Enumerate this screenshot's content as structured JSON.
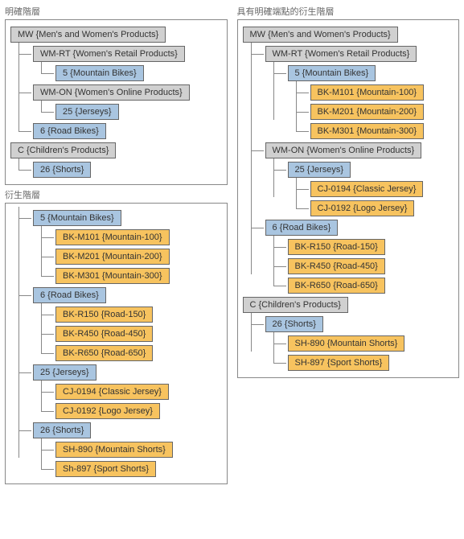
{
  "panels": {
    "explicit": {
      "title": "明確階層",
      "tree": [
        {
          "level": 0,
          "color": "gray",
          "text": "MW {Men's and Women's Products}"
        },
        {
          "level": 1,
          "color": "gray",
          "text": "WM-RT {Women's Retail Products}"
        },
        {
          "level": 2,
          "color": "blue",
          "text": "5 {Mountain Bikes}"
        },
        {
          "level": 1,
          "color": "gray",
          "text": "WM-ON {Women's Online Products}"
        },
        {
          "level": 2,
          "color": "blue",
          "text": "25 {Jerseys}"
        },
        {
          "level": 1,
          "color": "blue",
          "text": "6 {Road Bikes}"
        },
        {
          "level": 0,
          "color": "gray",
          "text": "C {Children's Products}"
        },
        {
          "level": 1,
          "color": "blue",
          "text": "26 {Shorts}"
        }
      ]
    },
    "derived": {
      "title": "衍生階層",
      "tree": [
        {
          "level": 1,
          "color": "blue",
          "text": "5 {Mountain Bikes}"
        },
        {
          "level": 2,
          "color": "orange",
          "text": "BK-M101 {Mountain-100}"
        },
        {
          "level": 2,
          "color": "orange",
          "text": "BK-M201 {Mountain-200}"
        },
        {
          "level": 2,
          "color": "orange",
          "text": "BK-M301 {Mountain-300}"
        },
        {
          "level": 1,
          "color": "blue",
          "text": "6 {Road Bikes}"
        },
        {
          "level": 2,
          "color": "orange",
          "text": "BK-R150 {Road-150}"
        },
        {
          "level": 2,
          "color": "orange",
          "text": "BK-R450 {Road-450}"
        },
        {
          "level": 2,
          "color": "orange",
          "text": "BK-R650 {Road-650}"
        },
        {
          "level": 1,
          "color": "blue",
          "text": "25 {Jerseys}"
        },
        {
          "level": 2,
          "color": "orange",
          "text": "CJ-0194 {Classic Jersey}"
        },
        {
          "level": 2,
          "color": "orange",
          "text": "CJ-0192 {Logo Jersey}"
        },
        {
          "level": 1,
          "color": "blue",
          "text": "26 {Shorts}"
        },
        {
          "level": 2,
          "color": "orange",
          "text": "SH-890 {Mountain Shorts}"
        },
        {
          "level": 2,
          "color": "orange",
          "text": "Sh-897 {Sport Shorts}"
        }
      ]
    },
    "combined": {
      "title": "具有明確端點的衍生階層",
      "tree": [
        {
          "level": 0,
          "color": "gray",
          "text": "MW {Men's and Women's Products}"
        },
        {
          "level": 1,
          "color": "gray",
          "text": "WM-RT {Women's Retail Products}"
        },
        {
          "level": 2,
          "color": "blue",
          "text": "5 {Mountain Bikes}"
        },
        {
          "level": 3,
          "color": "orange",
          "text": "BK-M101 {Mountain-100}"
        },
        {
          "level": 3,
          "color": "orange",
          "text": "BK-M201 {Mountain-200}"
        },
        {
          "level": 3,
          "color": "orange",
          "text": "BK-M301 {Mountain-300}"
        },
        {
          "level": 1,
          "color": "gray",
          "text": "WM-ON {Women's Online Products}"
        },
        {
          "level": 2,
          "color": "blue",
          "text": "25 {Jerseys}"
        },
        {
          "level": 3,
          "color": "orange",
          "text": "CJ-0194 {Classic Jersey}"
        },
        {
          "level": 3,
          "color": "orange",
          "text": "CJ-0192 {Logo Jersey}"
        },
        {
          "level": 1,
          "color": "blue",
          "text": "6 {Road Bikes}"
        },
        {
          "level": 2,
          "color": "orange",
          "text": "BK-R150 {Road-150}"
        },
        {
          "level": 2,
          "color": "orange",
          "text": "BK-R450 {Road-450}"
        },
        {
          "level": 2,
          "color": "orange",
          "text": "BK-R650 {Road-650}"
        },
        {
          "level": 0,
          "color": "gray",
          "text": "C {Children's Products}"
        },
        {
          "level": 1,
          "color": "blue",
          "text": "26 {Shorts}"
        },
        {
          "level": 2,
          "color": "orange",
          "text": "SH-890 {Mountain Shorts}"
        },
        {
          "level": 2,
          "color": "orange",
          "text": "SH-897 {Sport Shorts}"
        }
      ]
    }
  }
}
